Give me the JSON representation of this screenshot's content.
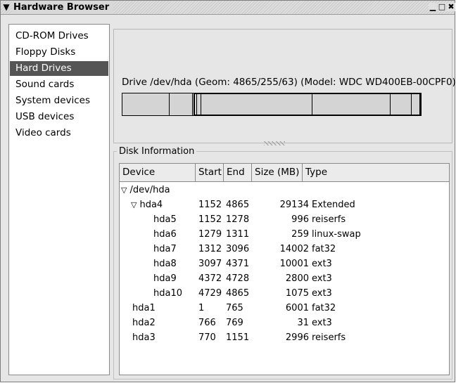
{
  "window": {
    "title": "Hardware Browser",
    "menu_icon": "chevron-down-icon",
    "controls": {
      "minimize": "▁",
      "maximize": "□",
      "close": "✖"
    }
  },
  "sidebar": {
    "items": [
      {
        "label": "CD-ROM Drives",
        "selected": false
      },
      {
        "label": "Floppy Disks",
        "selected": false
      },
      {
        "label": "Hard Drives",
        "selected": true
      },
      {
        "label": "Sound cards",
        "selected": false
      },
      {
        "label": "System devices",
        "selected": false
      },
      {
        "label": "USB devices",
        "selected": false
      },
      {
        "label": "Video cards",
        "selected": false
      }
    ]
  },
  "drive": {
    "label": "Drive /dev/hda (Geom: 4865/255/63) (Model: WDC WD400EB-00CPF0)"
  },
  "disk_info": {
    "legend": "Disk Information",
    "columns": [
      "Device",
      "Start",
      "End",
      "Size (MB)",
      "Type"
    ],
    "rows": [
      {
        "device": "/dev/hda",
        "start": "",
        "end": "",
        "size": "",
        "type": "",
        "expander": "▽"
      },
      {
        "device": "hda4",
        "start": "1152",
        "end": "4865",
        "size": "29134",
        "type": "Extended",
        "expander": "▽"
      },
      {
        "device": "hda5",
        "start": "1152",
        "end": "1278",
        "size": "996",
        "type": "reiserfs",
        "expander": ""
      },
      {
        "device": "hda6",
        "start": "1279",
        "end": "1311",
        "size": "259",
        "type": "linux-swap",
        "expander": ""
      },
      {
        "device": "hda7",
        "start": "1312",
        "end": "3096",
        "size": "14002",
        "type": "fat32",
        "expander": ""
      },
      {
        "device": "hda8",
        "start": "3097",
        "end": "4371",
        "size": "10001",
        "type": "ext3",
        "expander": ""
      },
      {
        "device": "hda9",
        "start": "4372",
        "end": "4728",
        "size": "2800",
        "type": "ext3",
        "expander": ""
      },
      {
        "device": "hda10",
        "start": "4729",
        "end": "4865",
        "size": "1075",
        "type": "ext3",
        "expander": ""
      },
      {
        "device": "hda1",
        "start": "1",
        "end": "765",
        "size": "6001",
        "type": "fat32",
        "expander": ""
      },
      {
        "device": "hda2",
        "start": "766",
        "end": "769",
        "size": "31",
        "type": "ext3",
        "expander": ""
      },
      {
        "device": "hda3",
        "start": "770",
        "end": "1151",
        "size": "2996",
        "type": "reiserfs",
        "expander": ""
      }
    ]
  },
  "colors": {
    "selected_bg": "#555555",
    "selected_fg": "#ffffff",
    "window_bg": "#e6e6e6"
  }
}
